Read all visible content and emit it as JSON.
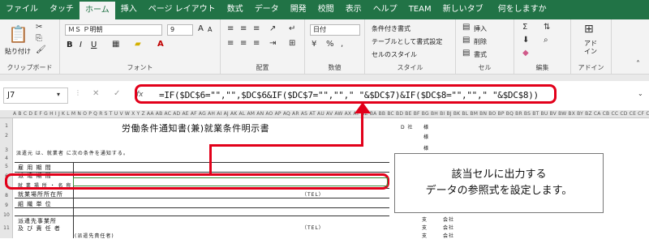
{
  "ribbon_tabs": [
    "ファイル",
    "タッチ",
    "ホーム",
    "挿入",
    "ページ レイアウト",
    "数式",
    "データ",
    "開発",
    "校閲",
    "表示",
    "ヘルプ",
    "TEAM",
    "新しいタブ",
    "何をしますか"
  ],
  "active_tab": "ホーム",
  "clipboard": {
    "paste_label": "貼り付け",
    "group_label": "クリップボード"
  },
  "font": {
    "name": "ＭＳ Ｐ明朝",
    "size": "9",
    "group_label": "フォント",
    "bold": "B",
    "italic": "I",
    "underline": "U",
    "grow": "A",
    "shrink": "A"
  },
  "alignment": {
    "group_label": "配置"
  },
  "number": {
    "format": "日付",
    "group_label": "数値"
  },
  "styles": {
    "conditional": "条件付き書式",
    "table": "テーブルとして書式設定",
    "cell": "セルのスタイル",
    "group_label": "スタイル"
  },
  "cells": {
    "insert": "挿入",
    "delete": "削除",
    "format": "書式",
    "group_label": "セル"
  },
  "editing": {
    "group_label": "編集"
  },
  "addin": {
    "label_line1": "アド",
    "label_line2": "イン",
    "group_label": "アドイン"
  },
  "formula_bar": {
    "name_box": "J7",
    "fx": "fx",
    "formula": "=IF($DC$6=\"\",\"\",$DC$6&IF($DC$7=\"\",\"\",\"  \"&$DC$7)&IF($DC$8=\"\",\"\",\"  \"&$DC$8))"
  },
  "sheet": {
    "column_header": "A B C D E F G H I J K L M N O P Q R S T U V W X Y Z AA AB AC AD AE AF AG AH AI AJ AK AL AM AN AO AP AQ AR AS AT AU AV AW AX AY AZ BA BB BC BD BE BF BG BH BI BJ BK BL BM BN BO BP BQ BR BS BT BU BV BW BX BY BZ CA CB CC CD CE CF CG CH CI CJ CK CL CM CN CO CP CQ CR CS CT CU CV CW CX CY CZ DA DB DC DD DE DF",
    "rows": [
      "1",
      "2",
      "3",
      "4",
      "5",
      "6",
      "7",
      "8",
      "9",
      "10",
      "11"
    ],
    "title": "労働条件通知書(兼)就業条件明示書",
    "note": "派遣元 は、就業者 に次の条件を通知する。",
    "labels": [
      "雇 用 期 間",
      "派 遣 期 間",
      "就 業 場 所 ・ 名 称",
      "就業場所所在所",
      "組 織 単 位",
      "派遣先事業所",
      "及 び 責 任 者",
      "(派遣先責任者)"
    ],
    "tel": "（TEL）",
    "tel2": "（TEL）",
    "side": [
      "D 社",
      "様",
      "様",
      "様",
      "支",
      "支",
      "支",
      "会社",
      "会社",
      "会社"
    ]
  },
  "callout": {
    "line1": "該当セルに出力する",
    "line2": "データの参照式を設定します。"
  },
  "colors": {
    "accent": "#217346",
    "highlight": "#e2001a"
  }
}
